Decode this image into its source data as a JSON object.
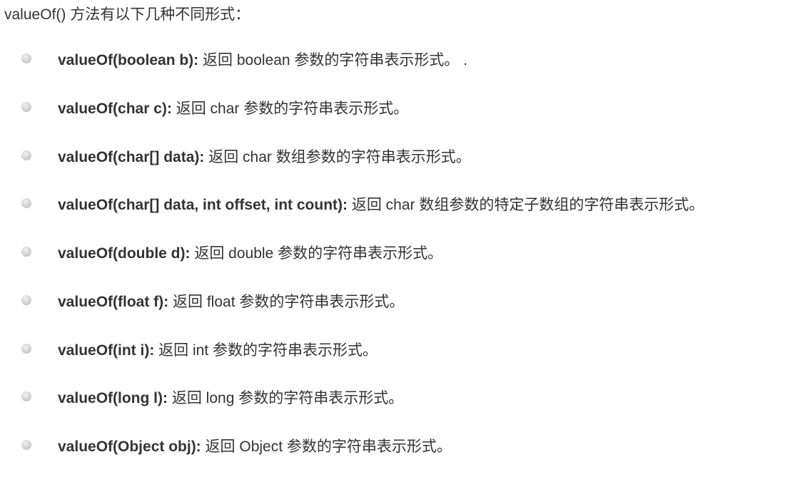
{
  "intro": "valueOf() 方法有以下几种不同形式：",
  "items": [
    {
      "signature": "valueOf(boolean b):",
      "description": " 返回 boolean 参数的字符串表示形式。 ."
    },
    {
      "signature": "valueOf(char c):",
      "description": " 返回 char 参数的字符串表示形式。"
    },
    {
      "signature": "valueOf(char[] data):",
      "description": " 返回 char 数组参数的字符串表示形式。"
    },
    {
      "signature": "valueOf(char[] data, int offset, int count):",
      "description": " 返回 char 数组参数的特定子数组的字符串表示形式。"
    },
    {
      "signature": "valueOf(double d):",
      "description": " 返回 double 参数的字符串表示形式。"
    },
    {
      "signature": "valueOf(float f):",
      "description": " 返回 float 参数的字符串表示形式。"
    },
    {
      "signature": "valueOf(int i):",
      "description": " 返回 int 参数的字符串表示形式。"
    },
    {
      "signature": "valueOf(long l):",
      "description": " 返回 long 参数的字符串表示形式。"
    },
    {
      "signature": "valueOf(Object obj):",
      "description": " 返回 Object 参数的字符串表示形式。"
    }
  ]
}
